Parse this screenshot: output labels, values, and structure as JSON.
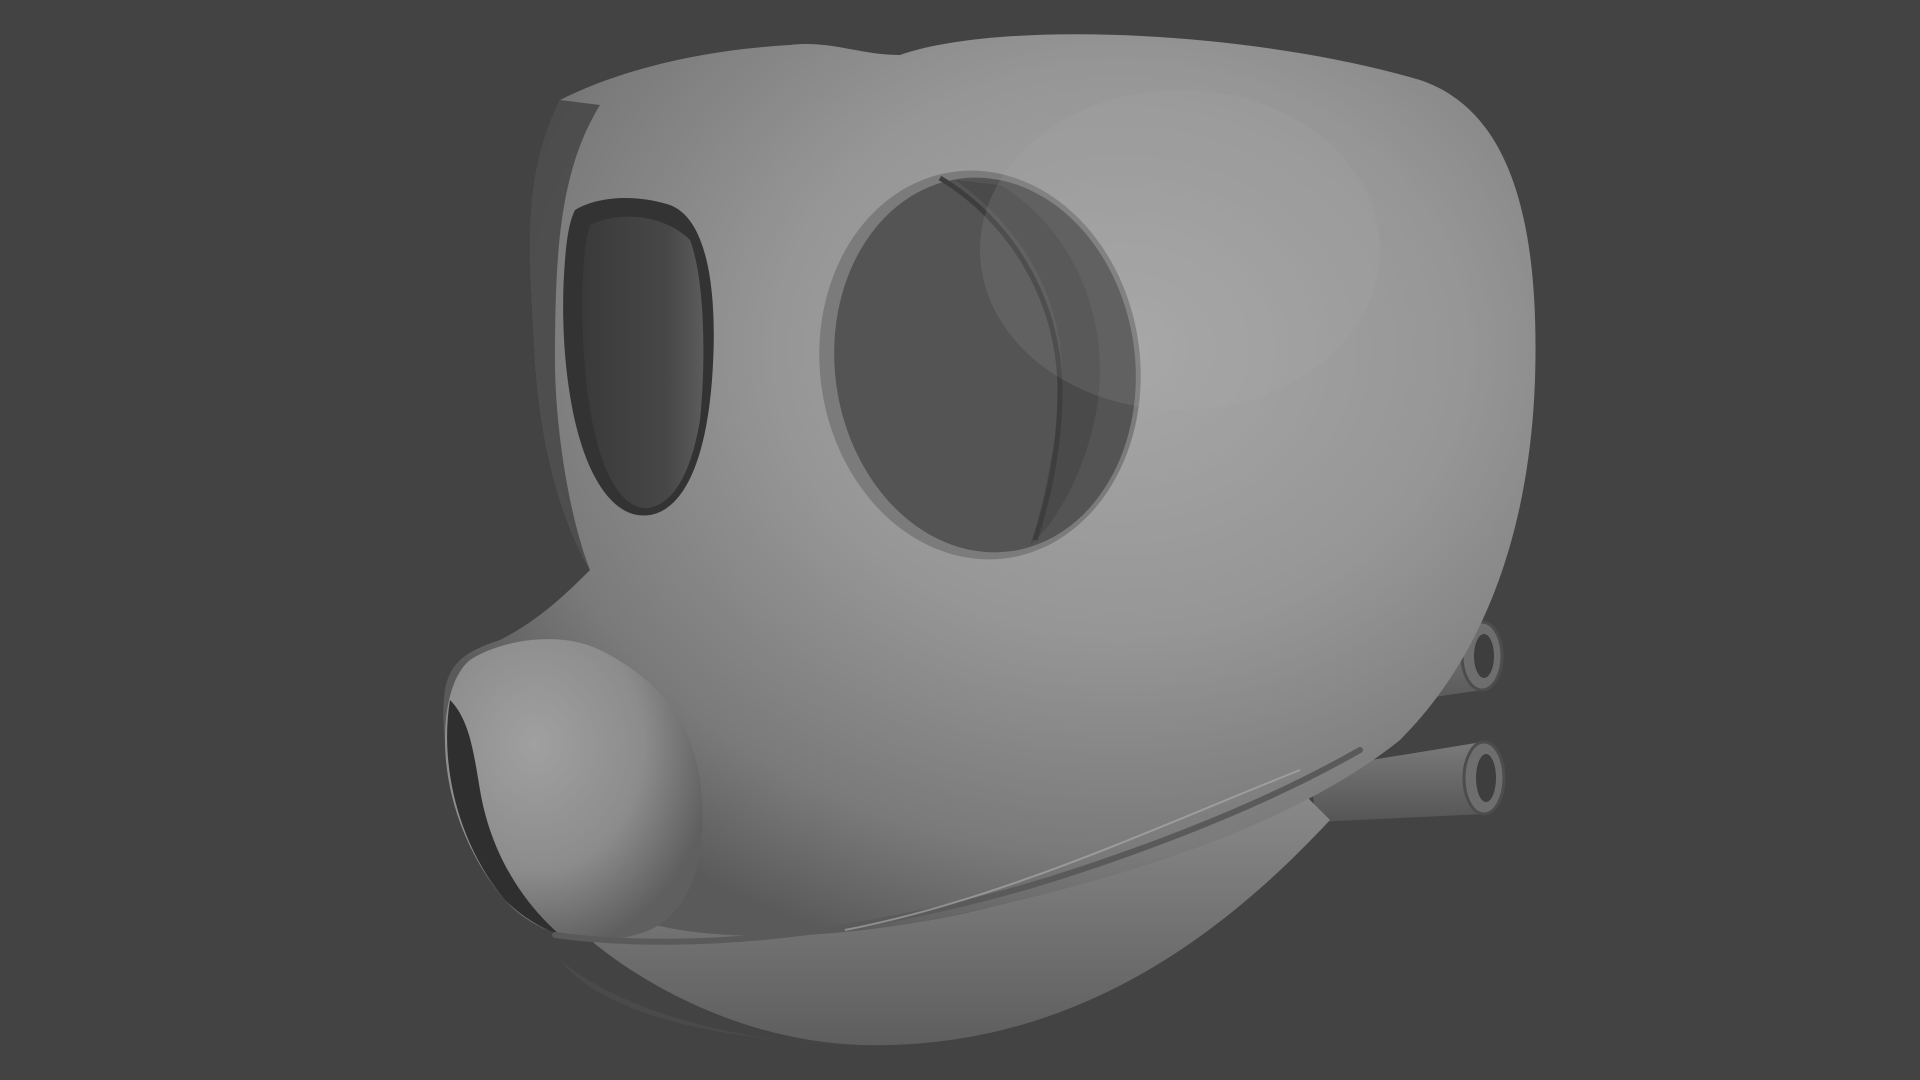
{
  "viewport": {
    "background_color": "#434343",
    "model": {
      "kind": "3d-render",
      "subject": "mask-head",
      "base_color": "#8f8f8f",
      "highlight_color": "#a8a8a8",
      "shadow_color": "#2f2f2f",
      "opening_color": "#525252",
      "features": [
        "eye-opening-left",
        "eye-opening-right",
        "snout",
        "jaw",
        "connector-pegs"
      ]
    }
  }
}
